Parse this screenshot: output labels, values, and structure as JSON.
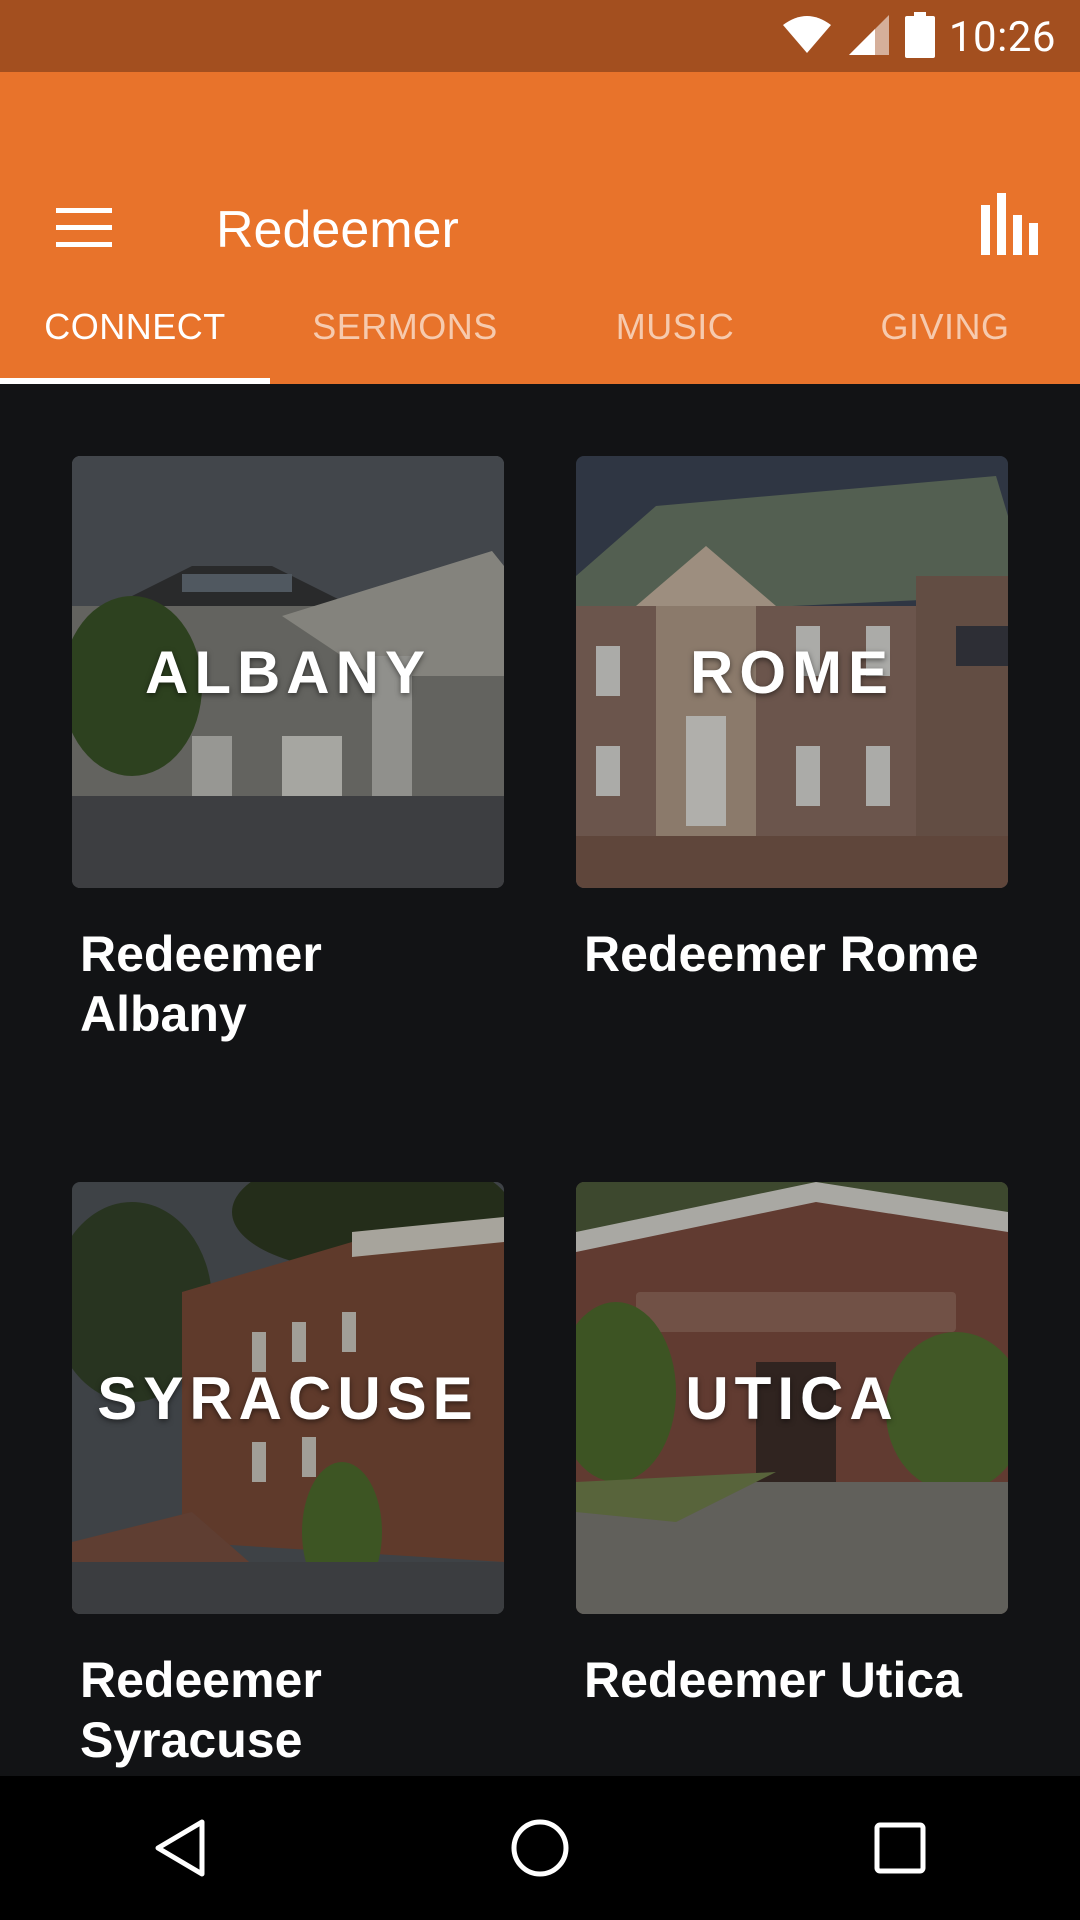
{
  "status_bar": {
    "time": "10:26",
    "icons": [
      "wifi-icon",
      "signal-icon",
      "battery-icon"
    ]
  },
  "app_bar": {
    "title": "Redeemer",
    "menu_icon": "hamburger-menu-icon",
    "action_icon": "bar-chart-icon"
  },
  "tabs": [
    {
      "label": "CONNECT",
      "active": true
    },
    {
      "label": "SERMONS",
      "active": false
    },
    {
      "label": "MUSIC",
      "active": false
    },
    {
      "label": "GIVING",
      "active": false
    }
  ],
  "cards": [
    {
      "overlay": "ALBANY",
      "title_line1": "Redeemer",
      "title_line2": "Albany"
    },
    {
      "overlay": "ROME",
      "title_line1": "Redeemer Rome",
      "title_line2": ""
    },
    {
      "overlay": "SYRACUSE",
      "title_line1": "Redeemer",
      "title_line2": "Syracuse"
    },
    {
      "overlay": "UTICA",
      "title_line1": "Redeemer Utica",
      "title_line2": ""
    }
  ],
  "colors": {
    "status_bar": "#a34f1f",
    "app_bar": "#e8732b",
    "background": "#121315",
    "nav_bar": "#000000"
  },
  "nav_bar": {
    "buttons": [
      "back-icon",
      "home-icon",
      "recents-icon"
    ]
  }
}
